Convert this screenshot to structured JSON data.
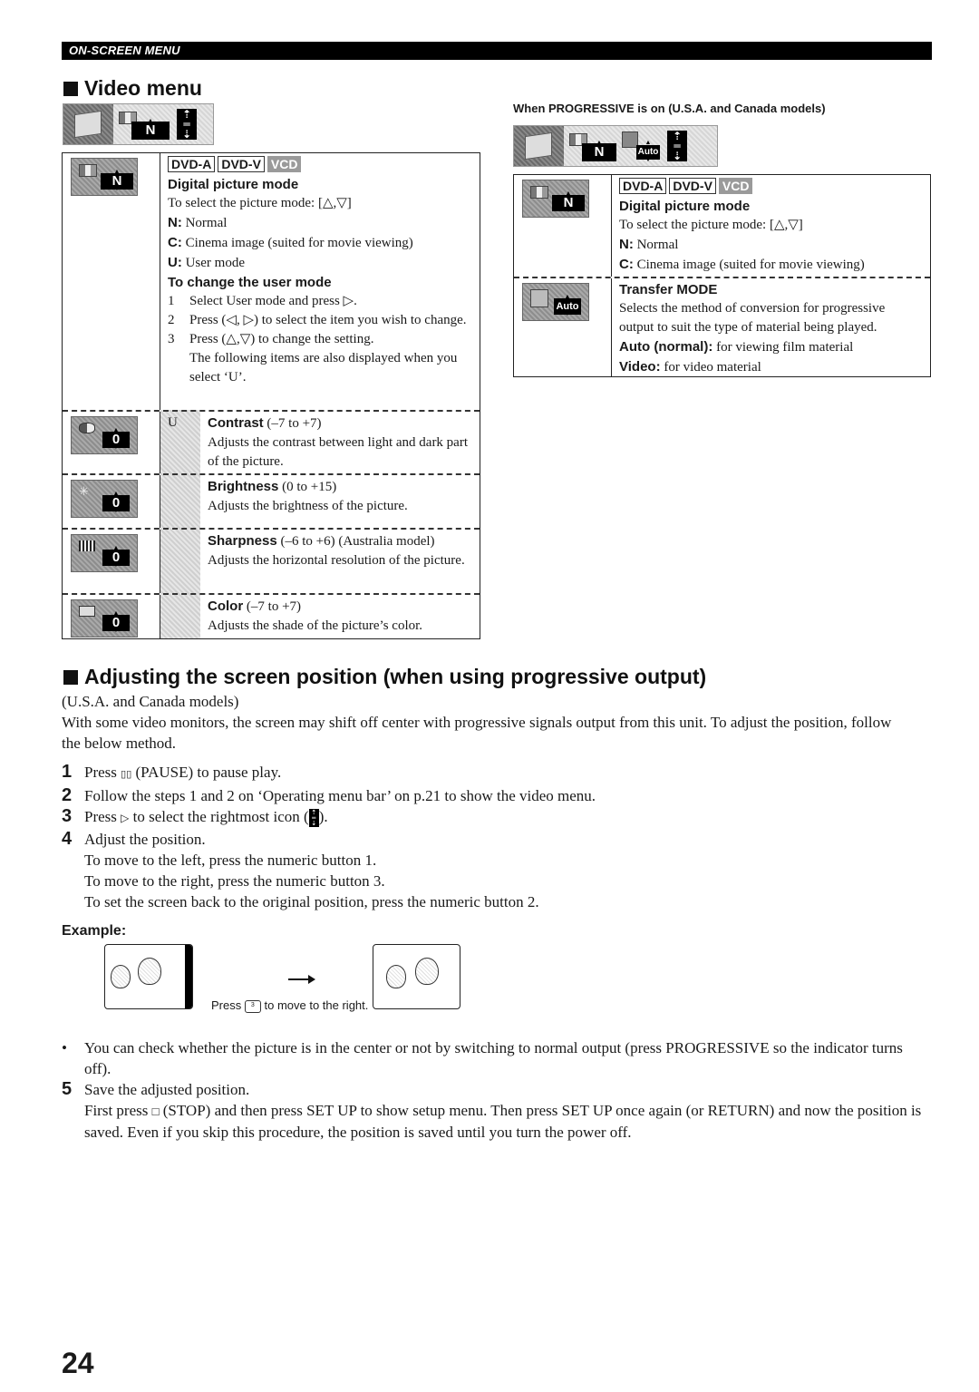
{
  "header": {
    "section_label": "ON-SCREEN MENU"
  },
  "video_menu": {
    "title": "Video menu",
    "strip_icons": [
      "video-menu-icon",
      "picture-mode-icon",
      "mode-value-N",
      "screen-position-icon"
    ],
    "strip_value": "N",
    "table": {
      "badges": [
        "DVD-A",
        "DVD-V",
        "VCD"
      ],
      "digital_picture_mode": {
        "title": "Digital picture mode",
        "select_text": "To select the picture mode: [△,▽]",
        "options": [
          {
            "key": "N:",
            "label": "Normal"
          },
          {
            "key": "C:",
            "label": "Cinema image (suited for movie viewing)"
          },
          {
            "key": "U:",
            "label": "User mode"
          }
        ],
        "icon_value": "N"
      },
      "change_user_mode": {
        "title": "To change the user mode",
        "steps": [
          {
            "n": "1",
            "text": "Select User mode and press ▷."
          },
          {
            "n": "2",
            "text": "Press (◁, ▷) to select the item you wish to change."
          },
          {
            "n": "3",
            "text": "Press (△,▽) to change the setting."
          }
        ],
        "note": "The following items are also displayed when you select ‘U’."
      },
      "user_marker": "U",
      "user_items": [
        {
          "name": "Contrast",
          "range": "(–7 to +7)",
          "desc": "Adjusts the contrast between light and dark part of the picture.",
          "icon": "contrast-icon",
          "value": "0"
        },
        {
          "name": "Brightness",
          "range": "(0 to +15)",
          "desc": "Adjusts the brightness of the picture.",
          "icon": "brightness-icon",
          "value": "0"
        },
        {
          "name": "Sharpness",
          "range": "(–6 to +6) (Australia model)",
          "desc": "Adjusts the horizontal resolution of the picture.",
          "icon": "sharpness-icon",
          "value": "0"
        },
        {
          "name": "Color",
          "range": "(–7 to +7)",
          "desc": "Adjusts the shade of the picture’s color.",
          "icon": "color-icon",
          "value": "0"
        }
      ]
    }
  },
  "progressive_menu": {
    "caption": "When PROGRESSIVE is on (U.S.A. and Canada models)",
    "strip_value": "N",
    "strip_transfer_value": "Auto",
    "badges": [
      "DVD-A",
      "DVD-V",
      "VCD"
    ],
    "digital_picture_mode": {
      "title": "Digital picture mode",
      "select_text": "To select the picture mode: [△,▽]",
      "options": [
        {
          "key": "N:",
          "label": "Normal"
        },
        {
          "key": "C:",
          "label": "Cinema image (suited for movie viewing)"
        }
      ],
      "icon_value": "N"
    },
    "transfer_mode": {
      "title": "Transfer MODE",
      "desc": "Selects the method of conversion for progressive output to suit the type of material being played.",
      "options": [
        {
          "key": "Auto (normal):",
          "label": "for viewing film material"
        },
        {
          "key": "Video:",
          "label": "for video material"
        }
      ],
      "icon_value": "Auto"
    }
  },
  "adjust_section": {
    "title": "Adjusting the screen position (when using progressive output)",
    "models": "(U.S.A. and Canada models)",
    "intro": "With some video monitors, the screen may shift off center with progressive signals output from this unit. To adjust the position, follow the below method.",
    "steps": [
      {
        "n": "1",
        "before": "Press ",
        "glyph": "▯▯",
        "after": " (PAUSE) to pause play."
      },
      {
        "n": "2",
        "before": "Follow the steps 1 and 2 on ‘Operating menu bar’ on p.21 to show the video menu.",
        "glyph": "",
        "after": ""
      },
      {
        "n": "3",
        "before": "Press ",
        "glyph": "▷",
        "after": " to select the rightmost icon (",
        "tail": ")."
      },
      {
        "n": "4",
        "before": "Adjust the position.",
        "glyph": "",
        "after": ""
      }
    ],
    "step4_lines": [
      "To move to the left, press the numeric button 1.",
      "To move to the right, press the numeric button 3.",
      "To set the screen back to the original position, press the numeric button 2."
    ],
    "example_label": "Example:",
    "example_caption_pre": "Press",
    "example_key": "3",
    "example_caption_post": "to move to the right.",
    "bullet": "You can check whether the picture is in the center or not by switching to normal output (press PROGRESSIVE so the indicator turns off).",
    "step5": {
      "n": "5",
      "text": "Save the adjusted position."
    },
    "step5_detail_pre": "First press ",
    "step5_glyph": "□",
    "step5_detail_post": " (STOP) and then press SET UP to show setup menu. Then press SET UP once again (or RETURN) and now the position is saved. Even if you skip this procedure, the position is saved until you turn the power off."
  },
  "page_number": "24"
}
